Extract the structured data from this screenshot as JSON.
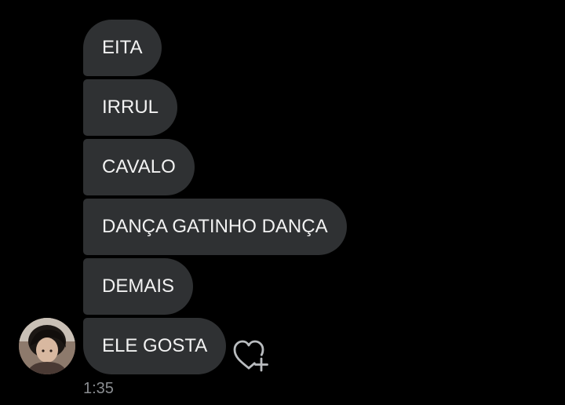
{
  "messages": [
    {
      "text": "EITA"
    },
    {
      "text": "IRRUL"
    },
    {
      "text": "CAVALO"
    },
    {
      "text": "DANÇA GATINHO DANÇA"
    },
    {
      "text": "DEMAIS"
    },
    {
      "text": "ELE GOSTA"
    }
  ],
  "timestamp": "1:35",
  "icons": {
    "avatar": "user-avatar",
    "like": "heart-plus-icon"
  },
  "colors": {
    "background": "#000000",
    "bubble": "#2f3133",
    "bubble_text": "#f2f2f2",
    "timestamp": "#8a8d91",
    "icon": "#b9bcbf"
  }
}
